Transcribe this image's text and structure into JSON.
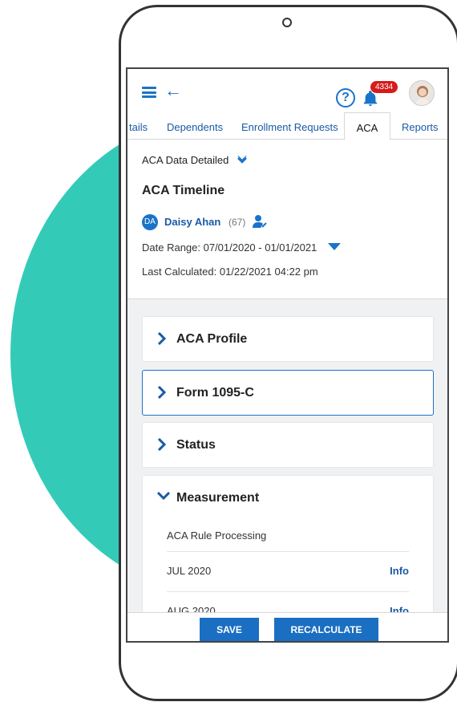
{
  "header": {
    "notification_count": "4334",
    "help_icon": "question-circle-icon"
  },
  "tabs": [
    {
      "label": "tails"
    },
    {
      "label": "Dependents"
    },
    {
      "label": "Enrollment Requests"
    },
    {
      "label": "ACA",
      "active": true
    },
    {
      "label": "Reports"
    }
  ],
  "section": {
    "view_selector": "ACA Data Detailed",
    "title": "ACA Timeline"
  },
  "employee": {
    "initials": "DA",
    "name": "Daisy Ahan",
    "age": "(67)"
  },
  "info": {
    "date_range": "Date Range: 07/01/2020 - 01/01/2021",
    "last_calculated": "Last Calculated: 01/22/2021 04:22 pm"
  },
  "cards": [
    {
      "title": "ACA Profile",
      "expanded": false
    },
    {
      "title": "Form 1095-C",
      "expanded": false
    },
    {
      "title": "Status",
      "expanded": false
    },
    {
      "title": "Measurement",
      "expanded": true
    }
  ],
  "measurement": {
    "heading": "ACA Rule Processing",
    "rows": [
      {
        "month": "JUL 2020",
        "link": "Info"
      },
      {
        "month": "AUG 2020",
        "link": "Info"
      }
    ]
  },
  "actions": {
    "save_label": "SAVE",
    "recalculate_label": "RECALCULATE"
  },
  "colors": {
    "accent": "#1a73c8",
    "button": "#1b6fc2",
    "badge": "#d61b1b",
    "teal": "#33cbb8"
  }
}
